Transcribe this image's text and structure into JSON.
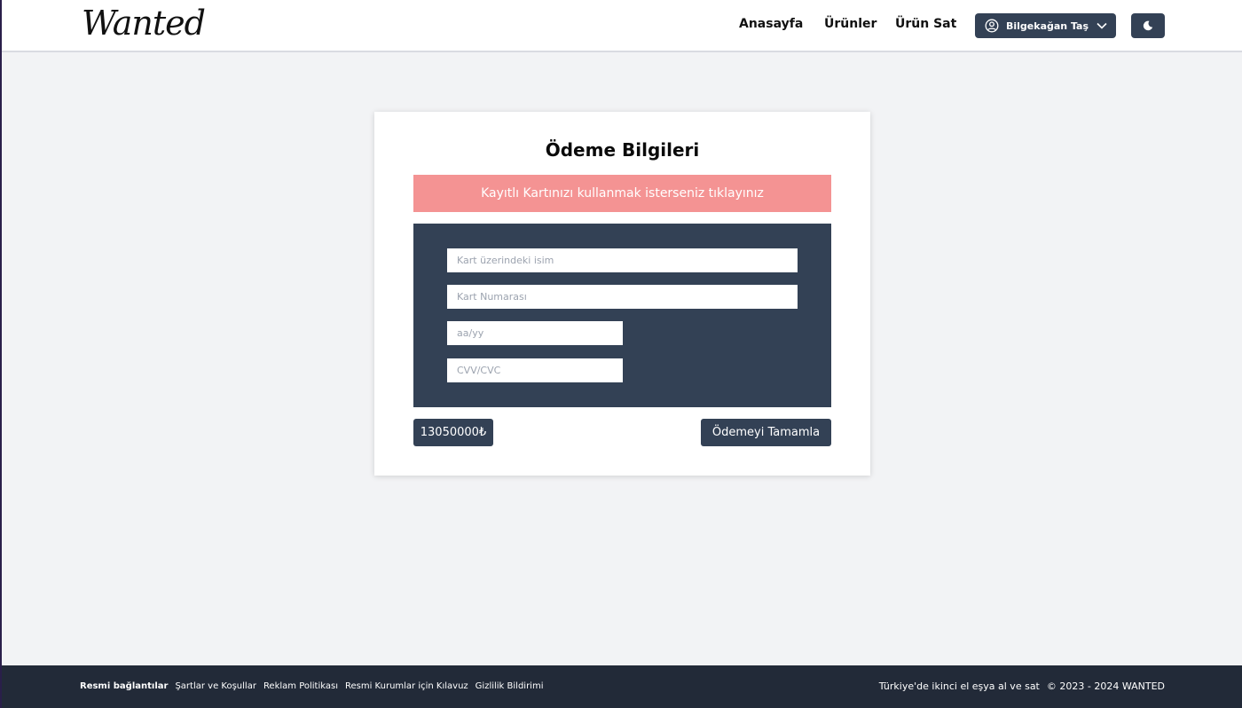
{
  "header": {
    "logo": "Wanted",
    "nav": [
      "Anasayfa",
      "Ürünler",
      "Ürün Sat"
    ],
    "user_name": "Bilgekağan Taş",
    "user_icon": "user-circle-icon",
    "dropdown_icon": "chevron-down-icon",
    "theme_icon": "moon-icon"
  },
  "payment": {
    "title": "Ödeme Bilgileri",
    "saved_card_banner": "Kayıtlı Kartınızı kullanmak isterseniz tıklayınız",
    "card_name_placeholder": "Kart üzerindeki isim",
    "card_number_placeholder": "Kart Numarası",
    "expiry_placeholder": "aa/yy",
    "cvv_placeholder": "CVV/CVC",
    "total": "13050000₺",
    "submit_label": "Ödemeyi Tamamla"
  },
  "footer": {
    "links_heading": "Resmi bağlantılar",
    "links": [
      "Şartlar ve Koşullar",
      "Reklam Politikası",
      "Resmi Kurumlar için Kılavuz",
      "Gizlilik Bildirimi"
    ],
    "tagline": "Türkiye'de ikinci el eşya al ve sat",
    "copyright": "© 2023 - 2024 WANTED"
  },
  "colors": {
    "primary": "#334155",
    "banner": "#f49393",
    "footer": "#222a38",
    "background": "#f2f3f5"
  }
}
